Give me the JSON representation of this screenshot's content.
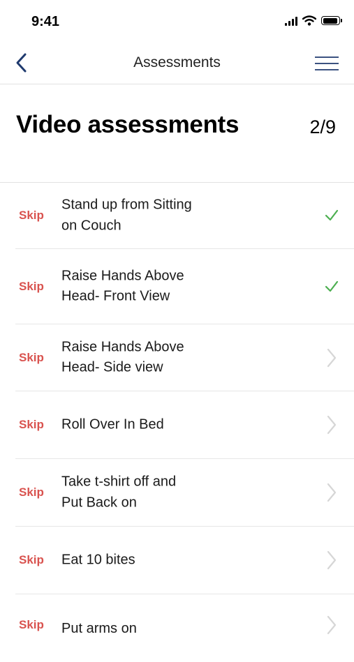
{
  "status_bar": {
    "time": "9:41",
    "icons": [
      "signal-icon",
      "wifi-icon",
      "battery-icon"
    ]
  },
  "nav": {
    "title": "Assessments",
    "back_icon": "chevron-left-icon",
    "menu_icon": "hamburger-menu-icon"
  },
  "header": {
    "title": "Video assessments",
    "progress": "2/9"
  },
  "colors": {
    "skip": "#d9534f",
    "check": "#4caf50",
    "accent": "#1f3a6e",
    "chevron": "#d6d6d6"
  },
  "items": [
    {
      "skip_label": "Skip",
      "label": "Stand up from Sitting on Couch",
      "status": "completed"
    },
    {
      "skip_label": "Skip",
      "label": "Raise Hands Above Head- Front View",
      "status": "completed"
    },
    {
      "skip_label": "Skip",
      "label": "Raise Hands Above Head- Side view",
      "status": "pending"
    },
    {
      "skip_label": "Skip",
      "label": "Roll Over In Bed",
      "status": "pending"
    },
    {
      "skip_label": "Skip",
      "label": "Take t-shirt off and Put Back on",
      "status": "pending"
    },
    {
      "skip_label": "Skip",
      "label": "Eat 10 bites",
      "status": "pending"
    },
    {
      "skip_label": "Skip",
      "label": "Put arms on",
      "status": "pending"
    }
  ]
}
